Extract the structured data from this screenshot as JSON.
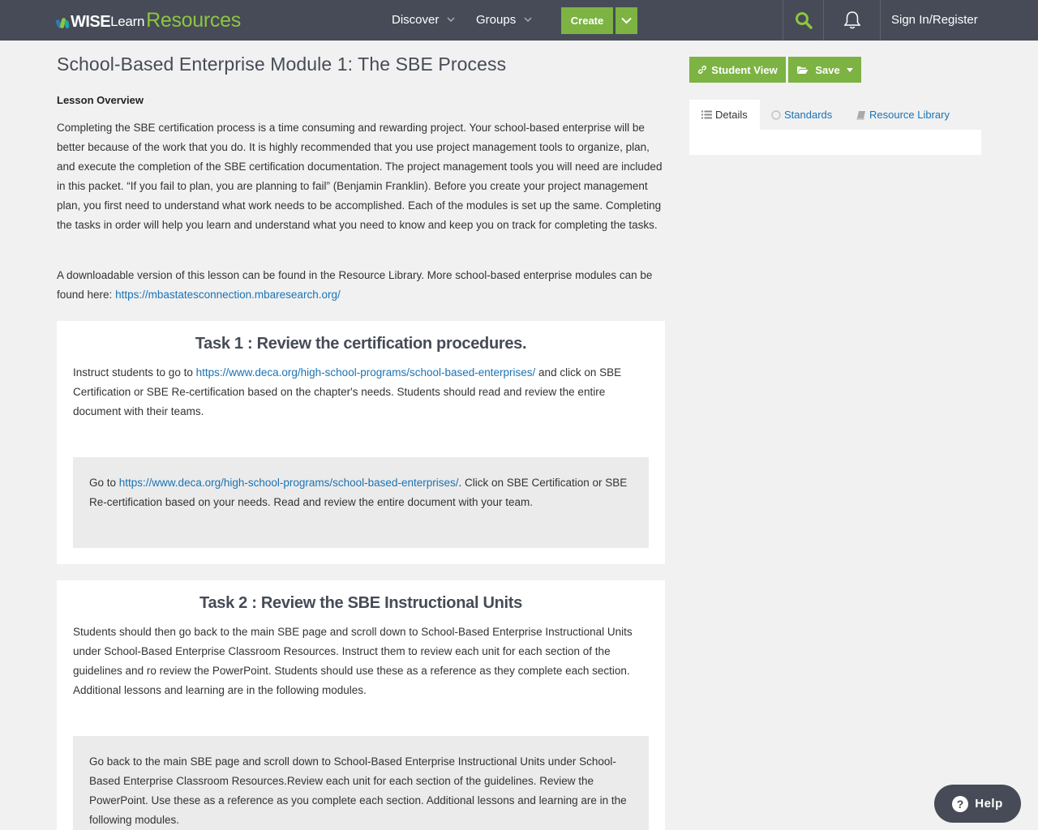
{
  "nav": {
    "logo_wise": "WISE",
    "logo_learn": "Learn",
    "logo_resources": "Resources",
    "discover": "Discover",
    "groups": "Groups",
    "create": "Create",
    "sign_in": "Sign In/Register"
  },
  "lesson": {
    "title": "School-Based Enterprise Module 1: The SBE Process",
    "overview_heading": "Lesson Overview",
    "overview_text": "Completing the SBE certification process is a time consuming and rewarding project. Your school-based enterprise will be better because of the work that you do. It is highly recommended that you use project management tools to organize, plan, and execute the completion of the SBE certification documentation. The project management tools you will need are included in this packet. “If you fail to plan, you are planning to fail” (Benjamin Franklin). Before you create your project management plan, you first need to understand what work needs to be accomplished. Each of the modules is set up the same. Completing the tasks in order will help you learn and understand what you need to know and keep you on track for completing the tasks.",
    "download_text": "A downloadable version of this lesson can be found in the Resource Library. More school-based enterprise modules can be found here: ",
    "download_link": "https://mbastatesconnection.mbaresearch.org/"
  },
  "tasks": [
    {
      "title": "Task 1 : Review the certification procedures.",
      "instr_before": "Instruct students to go to ",
      "instr_link": "https://www.deca.org/high-school-programs/school-based-enterprises/",
      "instr_after": " and click on SBE Certification or SBE Re-certification based on the chapter's needs. Students should read and review the entire document with their teams.",
      "student_before": "Go to ",
      "student_link": "https://www.deca.org/high-school-programs/school-based-enterprises/",
      "student_after": ". Click on SBE Certification or SBE Re-certification based on your needs. Read and review the entire document with your team."
    },
    {
      "title": "Task 2 : Review the SBE Instructional Units",
      "instr": "Students should then go back to the main SBE page and scroll down to School-Based Enterprise Instructional Units under School-Based Enterprise Classroom Resources. Instruct them to review each unit for each section of the guidelines and ro review the PowerPoint. Students should use these as a reference as they complete each section. Additional lessons and learning are in the following modules.",
      "student": "Go back to the main SBE page and scroll down to School-Based Enterprise Instructional Units under School-Based Enterprise Classroom Resources.Review each unit for each section of the guidelines. Review the PowerPoint. Use these as a reference as you complete each section. Additional lessons and learning are in the following modules."
    }
  ],
  "sidebar": {
    "student_view": "Student View",
    "save": "Save",
    "tabs": [
      {
        "label": "Details",
        "icon": "list-icon"
      },
      {
        "label": "Standards",
        "icon": "circle-icon"
      },
      {
        "label": "Resource Library",
        "icon": "book-icon"
      }
    ]
  },
  "help": {
    "label": "Help"
  },
  "colors": {
    "nav_bg": "#464b57",
    "accent_green": "#7cb342",
    "link_blue": "#1a73b5",
    "page_bg": "#f1f1f1"
  }
}
